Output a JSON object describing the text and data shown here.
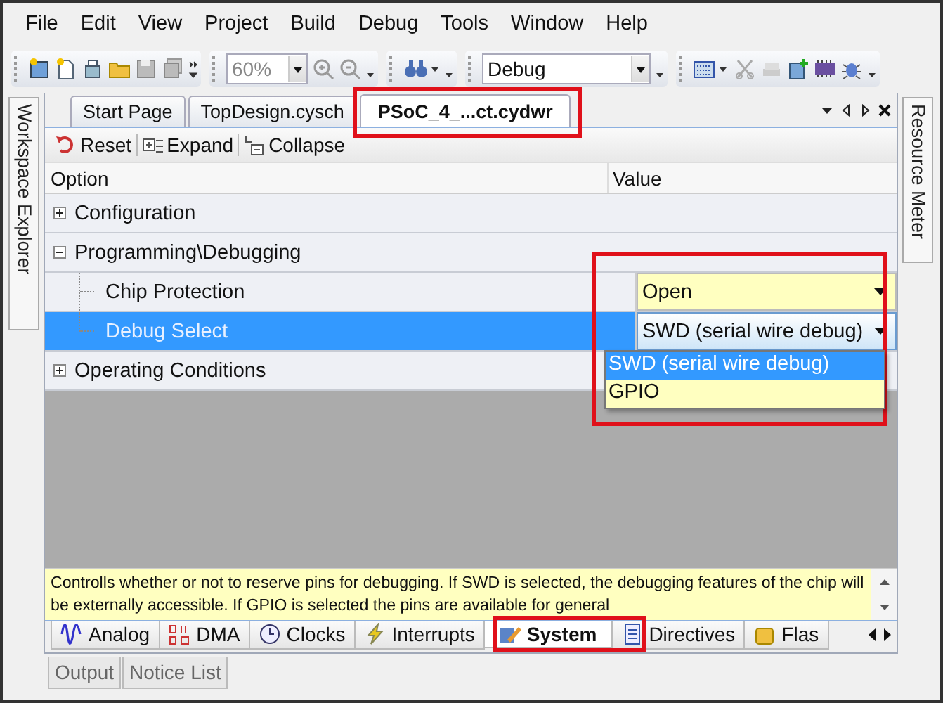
{
  "menu": [
    "File",
    "Edit",
    "View",
    "Project",
    "Build",
    "Debug",
    "Tools",
    "Window",
    "Help"
  ],
  "toolbar": {
    "zoom": "60%",
    "configuration": "Debug"
  },
  "left_panel_tab": "Workspace Explorer",
  "right_panel_tab": "Resource Meter",
  "document_tabs": [
    {
      "label": "Start Page",
      "selected": false
    },
    {
      "label": "TopDesign.cysch",
      "selected": false
    },
    {
      "label": "PSoC_4_...ct.cydwr",
      "selected": true
    }
  ],
  "editor_toolbar": [
    "Reset",
    "Expand",
    "Collapse"
  ],
  "grid": {
    "columns": [
      "Option",
      "Value"
    ],
    "rows": [
      {
        "label": "Configuration",
        "expanded": false
      },
      {
        "label": "Programming\\Debugging",
        "expanded": true,
        "children": [
          {
            "label": "Chip Protection",
            "value": "Open",
            "selected": false
          },
          {
            "label": "Debug Select",
            "value": "SWD (serial wire debug)",
            "selected": true,
            "options": [
              {
                "label": "SWD (serial wire debug)",
                "selected": true
              },
              {
                "label": "GPIO",
                "selected": false
              }
            ]
          }
        ]
      },
      {
        "label": "Operating Conditions",
        "expanded": false
      }
    ]
  },
  "description": "Controlls whether or not to reserve pins for debugging. If SWD is selected, the debugging features of the chip will be externally accessible. If GPIO is selected the pins are available for general",
  "bottom_tabs": [
    {
      "label": "Analog",
      "selected": false
    },
    {
      "label": "DMA",
      "selected": false
    },
    {
      "label": "Clocks",
      "selected": false
    },
    {
      "label": "Interrupts",
      "selected": false
    },
    {
      "label": "System",
      "selected": true
    },
    {
      "label": "Directives",
      "selected": false
    },
    {
      "label": "Flas",
      "selected": false
    }
  ],
  "output_tabs": [
    "Output",
    "Notice List"
  ]
}
